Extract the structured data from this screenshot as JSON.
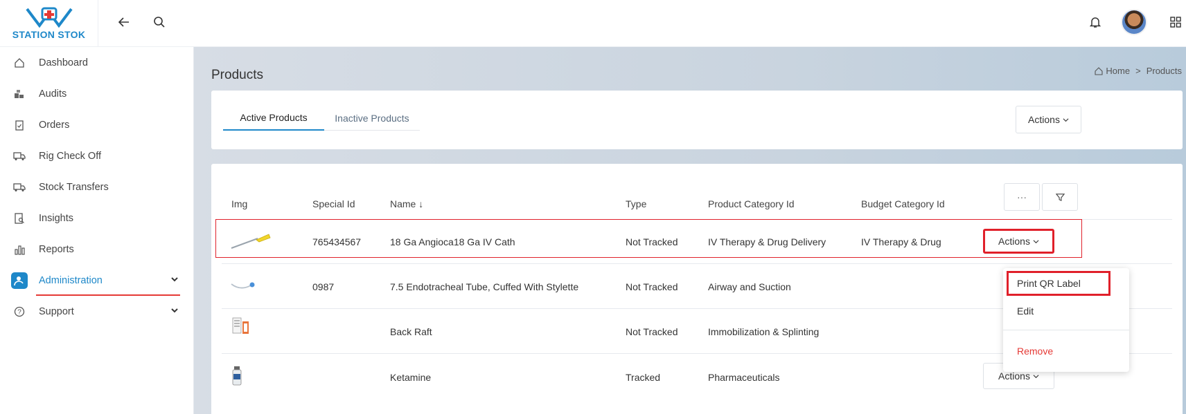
{
  "brand": {
    "name": "STATION STOK"
  },
  "sidebar": {
    "items": [
      {
        "label": "Dashboard",
        "icon": "home-icon"
      },
      {
        "label": "Audits",
        "icon": "boxes-icon"
      },
      {
        "label": "Orders",
        "icon": "clipboard-icon"
      },
      {
        "label": "Rig Check Off",
        "icon": "truck-icon"
      },
      {
        "label": "Stock Transfers",
        "icon": "truck-transfer-icon"
      },
      {
        "label": "Insights",
        "icon": "insights-icon"
      },
      {
        "label": "Reports",
        "icon": "bar-chart-icon"
      },
      {
        "label": "Administration",
        "icon": "admin-user-icon",
        "active": true
      },
      {
        "label": "Support",
        "icon": "question-circle-icon"
      }
    ]
  },
  "page": {
    "title": "Products",
    "breadcrumb": {
      "home": "Home",
      "separator": ">",
      "current": "Products"
    }
  },
  "tabs": [
    {
      "label": "Active Products",
      "active": true
    },
    {
      "label": "Inactive Products",
      "active": false
    }
  ],
  "top_actions_label": "Actions",
  "table": {
    "columns": [
      "Img",
      "Special Id",
      "Name ↓",
      "Type",
      "Product Category Id",
      "Budget Category Id"
    ],
    "more_label": "···",
    "rows": [
      {
        "special_id": "765434567",
        "name": "18 Ga Angioca18 Ga IV Cath",
        "type": "Not Tracked",
        "product_category": "IV Therapy & Drug Delivery",
        "budget_category": "IV Therapy & Drug",
        "actions": "Actions"
      },
      {
        "special_id": "0987",
        "name": "7.5 Endotracheal Tube, Cuffed With Stylette",
        "type": "Not Tracked",
        "product_category": "Airway and Suction",
        "budget_category": "",
        "actions": ""
      },
      {
        "special_id": "",
        "name": "Back Raft",
        "type": "Not Tracked",
        "product_category": "Immobilization & Splinting",
        "budget_category": "",
        "actions": ""
      },
      {
        "special_id": "",
        "name": "Ketamine",
        "type": "Tracked",
        "product_category": "Pharmaceuticals",
        "budget_category": "",
        "actions": "Actions"
      }
    ]
  },
  "dropdown": {
    "items": [
      {
        "label": "Print QR Label"
      },
      {
        "label": "Edit"
      },
      {
        "label": "Remove"
      }
    ]
  },
  "colors": {
    "accent": "#1e88c9",
    "highlight": "#e0202a",
    "danger": "#e53935"
  }
}
